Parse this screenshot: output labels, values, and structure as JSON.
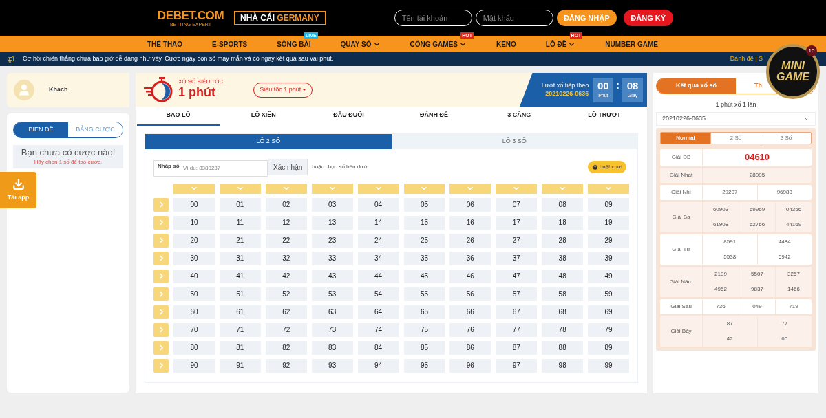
{
  "header": {
    "logo": "DEBET.COM",
    "logo_tagline": "BETTING EXPERT",
    "brand_tag": {
      "prefix": "NHÀ CÁI",
      "highlight": "GERMANY"
    },
    "username": {
      "placeholder": "Tên tài khoản"
    },
    "password": {
      "placeholder": "Mật khẩu"
    },
    "login": "ĐĂNG NHẬP",
    "register": "ĐĂNG KÝ"
  },
  "nav": [
    {
      "label": "THỂ THAO",
      "kind": "plain"
    },
    {
      "label": "E-SPORTS",
      "kind": "plain"
    },
    {
      "label": "SÒNG BÀI",
      "badge": "LIVE",
      "kind": "live"
    },
    {
      "label": "QUAY SỐ",
      "dropdown": true,
      "kind": "plain"
    },
    {
      "label": "CỔNG GAMES",
      "dropdown": true,
      "badge": "HOT",
      "kind": "hot"
    },
    {
      "label": "KENO",
      "kind": "plain"
    },
    {
      "label": "LÔ ĐỀ",
      "dropdown": true,
      "badge": "HOT",
      "kind": "hot"
    },
    {
      "label": "NUMBER GAME",
      "kind": "plain"
    }
  ],
  "ticker": {
    "message": "Cơ hội chiến thắng chưa bao giờ dễ dàng như vậy. Cược ngay con số may mắn và có ngay kết quả sau vài phút.",
    "links": "Đánh đề | S"
  },
  "minigame": {
    "line1": "MINI",
    "line2": "GAME",
    "count": "10"
  },
  "download": {
    "label": "Tải app"
  },
  "sidebar": {
    "user": "Khách",
    "tabs": [
      {
        "label": "BIÊN ĐỀ",
        "selected": true
      },
      {
        "label": "BẢNG CƯỢC",
        "selected": false
      }
    ],
    "empty_title": "Bạn chưa có cược nào!",
    "empty_hint": "Hãy chọn 1 số để tạo cược."
  },
  "game": {
    "caption": "XỔ SỐ SIÊU TỐC",
    "title": "1 phút",
    "mode": "Siêu tốc 1 phút",
    "next_label": "Lượt xổ tiếp theo",
    "next_id": "20210226-0636",
    "timer": [
      {
        "value": "00",
        "unit": "Phút"
      },
      {
        "value": "08",
        "unit": "Giây"
      }
    ],
    "timer_sep": ":",
    "tabs": [
      {
        "label": "BAO LÔ",
        "selected": true
      },
      {
        "label": "LÔ XIÊN",
        "selected": false
      },
      {
        "label": "ĐẦU ĐUÔI",
        "selected": false
      },
      {
        "label": "ĐÁNH ĐỀ",
        "selected": false
      },
      {
        "label": "3 CÀNG",
        "selected": false
      },
      {
        "label": "LÔ TRƯỢT",
        "selected": false
      }
    ],
    "subtabs": [
      {
        "label": "LÔ 2 SỐ",
        "selected": true
      },
      {
        "label": "LÔ 3 SỐ",
        "selected": false
      }
    ],
    "input": {
      "label": "Nhập số",
      "placeholder": "Ví dụ: 8383237",
      "button": "Xác nhận",
      "hint": "hoặc chọn số bên dưới"
    },
    "rules": "Luật chơi",
    "numbers": [
      [
        "00",
        "01",
        "02",
        "03",
        "04",
        "05",
        "06",
        "07",
        "08",
        "09"
      ],
      [
        "10",
        "11",
        "12",
        "13",
        "14",
        "15",
        "16",
        "17",
        "18",
        "19"
      ],
      [
        "20",
        "21",
        "22",
        "23",
        "24",
        "25",
        "26",
        "27",
        "28",
        "29"
      ],
      [
        "30",
        "31",
        "32",
        "33",
        "34",
        "35",
        "36",
        "37",
        "38",
        "39"
      ],
      [
        "40",
        "41",
        "42",
        "43",
        "44",
        "45",
        "46",
        "47",
        "48",
        "49"
      ],
      [
        "50",
        "51",
        "52",
        "53",
        "54",
        "55",
        "56",
        "57",
        "58",
        "59"
      ],
      [
        "60",
        "61",
        "62",
        "63",
        "64",
        "65",
        "66",
        "67",
        "68",
        "69"
      ],
      [
        "70",
        "71",
        "72",
        "73",
        "74",
        "75",
        "76",
        "77",
        "78",
        "79"
      ],
      [
        "80",
        "81",
        "82",
        "83",
        "84",
        "85",
        "86",
        "87",
        "88",
        "89"
      ],
      [
        "90",
        "91",
        "92",
        "93",
        "94",
        "95",
        "96",
        "97",
        "98",
        "99"
      ]
    ]
  },
  "results": {
    "tabs": [
      {
        "label": "Kết quả xổ số",
        "selected": true
      },
      {
        "label": "Th",
        "selected": false
      }
    ],
    "subtitle": "1 phút xổ 1 lần",
    "draw": "20210226-0635",
    "modes": [
      {
        "label": "Normal",
        "selected": true
      },
      {
        "label": "2 Số",
        "selected": false
      },
      {
        "label": "3 Số",
        "selected": false
      }
    ],
    "prizes": [
      {
        "name": "Giải ĐB",
        "kind": "special",
        "lines": [
          [
            "04610"
          ]
        ]
      },
      {
        "name": "Giải Nhất",
        "kind": "normal",
        "lines": [
          [
            "28095"
          ]
        ]
      },
      {
        "name": "Giải Nhì",
        "kind": "normal",
        "lines": [
          [
            "29207",
            "96983"
          ]
        ]
      },
      {
        "name": "Giải Ba",
        "kind": "normal",
        "lines": [
          [
            "60903",
            "69969",
            "04356"
          ],
          [
            "61908",
            "52766",
            "44169"
          ]
        ]
      },
      {
        "name": "Giải Tư",
        "kind": "normal",
        "lines": [
          [
            "8591",
            "4484"
          ],
          [
            "5538",
            "6942"
          ]
        ]
      },
      {
        "name": "Giải Năm",
        "kind": "normal",
        "lines": [
          [
            "2199",
            "5507",
            "3257"
          ],
          [
            "4952",
            "9837",
            "1466"
          ]
        ]
      },
      {
        "name": "Giải Sáu",
        "kind": "normal",
        "lines": [
          [
            "736",
            "049",
            "719"
          ]
        ]
      },
      {
        "name": "Giải Bảy",
        "kind": "normal",
        "lines": [
          [
            "87",
            "77"
          ],
          [
            "42",
            "60"
          ]
        ]
      }
    ]
  }
}
